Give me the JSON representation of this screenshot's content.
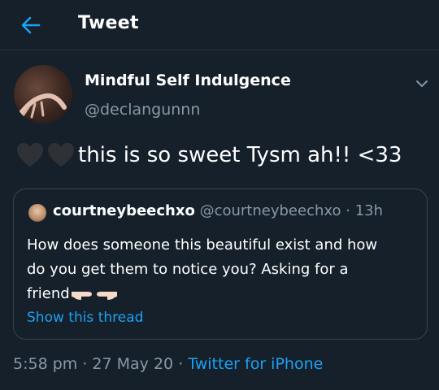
{
  "header": {
    "title": "Tweet",
    "back_icon": "arrow-left-icon"
  },
  "tweet": {
    "author": {
      "display_name": "Mindful Self Indulgence",
      "handle": "@declangunnn"
    },
    "text": "this is so sweet Tysm  ah!! <33",
    "emojis": [
      "black-heart",
      "black-heart"
    ],
    "time": "5:58 pm",
    "date": "27 May 20",
    "source": "Twitter for iPhone",
    "separator": "·"
  },
  "quote": {
    "display_name": "courtneybeechxo",
    "handle": "@courtneybeechxo",
    "time_ago": "13h",
    "separator": "·",
    "text_lines": [
      "How does someone this beautiful exist and how",
      "do you get them to notice you? Asking for a",
      "friend"
    ],
    "emojis": [
      "pointing-right",
      "pointing-left"
    ],
    "show_thread": "Show this thread"
  },
  "colors": {
    "background": "#15202b",
    "text": "#ffffff",
    "secondary": "#8899a6",
    "accent": "#1da1f2",
    "border": "#38444d"
  }
}
